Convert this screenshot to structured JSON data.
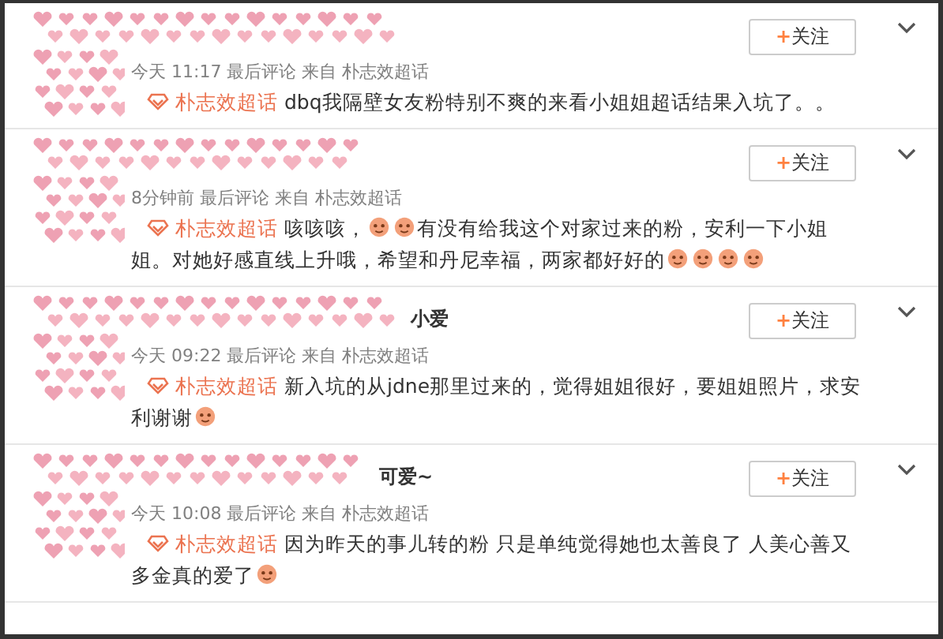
{
  "comments": [
    {
      "meta": "今天 11:17 最后评论 来自 朴志效超话",
      "follow": "关注",
      "follow_plus": "+",
      "topic": "朴志效超话",
      "lines": [
        [
          {
            "kind": "text",
            "text": "dbq我隔壁女友粉特别不爽的来看小姐姐超话结果入坑了。。"
          }
        ]
      ]
    },
    {
      "meta": "8分钟前 最后评论 来自 朴志效超话",
      "follow": "关注",
      "follow_plus": "+",
      "topic": "朴志效超话",
      "lines": [
        [
          {
            "kind": "text",
            "text": "咳咳咳，"
          },
          {
            "kind": "emoji"
          },
          {
            "kind": "emoji"
          },
          {
            "kind": "text",
            "text": "有没有给我这个对家过来的粉，安利一下小姐"
          }
        ],
        [
          {
            "kind": "text",
            "text": "姐。对她好感直线上升哦，希望和丹尼幸福，两家都好好的"
          },
          {
            "kind": "emoji"
          },
          {
            "kind": "emoji"
          },
          {
            "kind": "emoji"
          },
          {
            "kind": "emoji"
          }
        ]
      ]
    },
    {
      "name": "小爱",
      "meta": "今天 09:22 最后评论 来自 朴志效超话",
      "follow": "关注",
      "follow_plus": "+",
      "topic": "朴志效超话",
      "lines": [
        [
          {
            "kind": "text",
            "text": "新入坑的从jdne那里过来的，觉得姐姐很好，要姐姐照片，求安"
          }
        ],
        [
          {
            "kind": "text",
            "text": "利谢谢"
          },
          {
            "kind": "emoji"
          }
        ]
      ]
    },
    {
      "name": "可爱~",
      "meta": "今天 10:08 最后评论 来自 朴志效超话",
      "follow": "关注",
      "follow_plus": "+",
      "topic": "朴志效超话",
      "lines": [
        [
          {
            "kind": "text",
            "text": "因为昨天的事儿转的粉 只是单纯觉得她也太善良了  人美心善又"
          }
        ],
        [
          {
            "kind": "text",
            "text": "多金真的爱了"
          },
          {
            "kind": "emoji"
          }
        ]
      ]
    }
  ]
}
